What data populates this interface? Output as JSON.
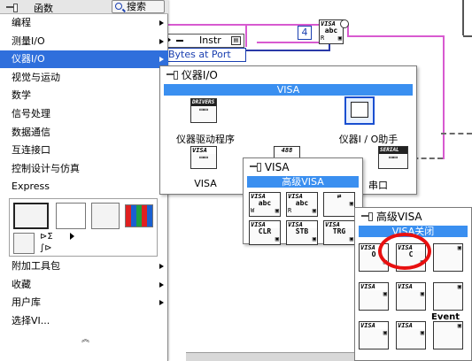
{
  "palette": {
    "title": "函数",
    "search_label": "搜索",
    "items": [
      {
        "label": "编程",
        "has_submenu": true
      },
      {
        "label": "测量I/O",
        "has_submenu": true
      },
      {
        "label": "仪器I/O",
        "has_submenu": true,
        "selected": true
      },
      {
        "label": "视觉与运动",
        "has_submenu": true
      },
      {
        "label": "数学",
        "has_submenu": true
      },
      {
        "label": "信号处理",
        "has_submenu": true
      },
      {
        "label": "数据通信",
        "has_submenu": true
      },
      {
        "label": "互连接口",
        "has_submenu": true
      },
      {
        "label": "控制设计与仿真",
        "has_submenu": true
      },
      {
        "label": "Express",
        "has_submenu": true
      }
    ],
    "bottom_items": [
      {
        "label": "附加工具包",
        "has_submenu": true
      },
      {
        "label": "收藏",
        "has_submenu": true
      },
      {
        "label": "用户库",
        "has_submenu": true
      },
      {
        "label": "选择VI...",
        "has_submenu": false
      }
    ]
  },
  "diagram": {
    "instr_label": "Instr",
    "bytes_label": "Bytes at Port",
    "numeric_value": "4",
    "visa_abc_top": "VISA",
    "visa_abc_mid": "abc",
    "visa_abc_r": "R"
  },
  "instr_panel": {
    "title": "仪器I/O",
    "bar": "VISA",
    "drivers_label": "仪器驱动程序",
    "drivers_icon": "DRIVERS",
    "assistant_label": "仪器I / O助手",
    "visa_label": "VISA",
    "gpib_icon": "488",
    "serial_icon": "SERIAL",
    "serial_label": "串口"
  },
  "visa_panel": {
    "title": "VISA",
    "bar": "高级VISA",
    "icons": [
      {
        "top": "VISA",
        "mid": "abc",
        "bot": "W"
      },
      {
        "top": "VISA",
        "mid": "abc",
        "bot": "R"
      },
      {
        "top": "",
        "mid": "⇄",
        "bot": ""
      },
      {
        "top": "VISA",
        "mid": "CLR",
        "bot": ""
      },
      {
        "top": "VISA",
        "mid": "STB",
        "bot": ""
      },
      {
        "top": "VISA",
        "mid": "TRG",
        "bot": ""
      }
    ]
  },
  "adv_panel": {
    "title": "高级VISA",
    "bar": "VISA关闭",
    "event_label": "Event",
    "icons": [
      {
        "top": "VISA",
        "mid": "O",
        "bot": ""
      },
      {
        "top": "VISA",
        "mid": "C",
        "bot": ""
      },
      {
        "top": "",
        "mid": "",
        "bot": ""
      },
      {
        "top": "VISA",
        "mid": "",
        "bot": ""
      },
      {
        "top": "VISA",
        "mid": "",
        "bot": ""
      },
      {
        "top": "",
        "mid": "",
        "bot": ""
      },
      {
        "top": "VISA",
        "mid": "",
        "bot": ""
      },
      {
        "top": "VISA",
        "mid": "",
        "bot": ""
      },
      {
        "top": "",
        "mid": "",
        "bot": ""
      }
    ]
  },
  "colors": {
    "selection": "#2f6fdc",
    "panel_bar": "#3a8ff0",
    "highlight_circle": "#e81010",
    "wire_pink": "#d85ad0",
    "wire_blue": "#2a3aa8"
  }
}
